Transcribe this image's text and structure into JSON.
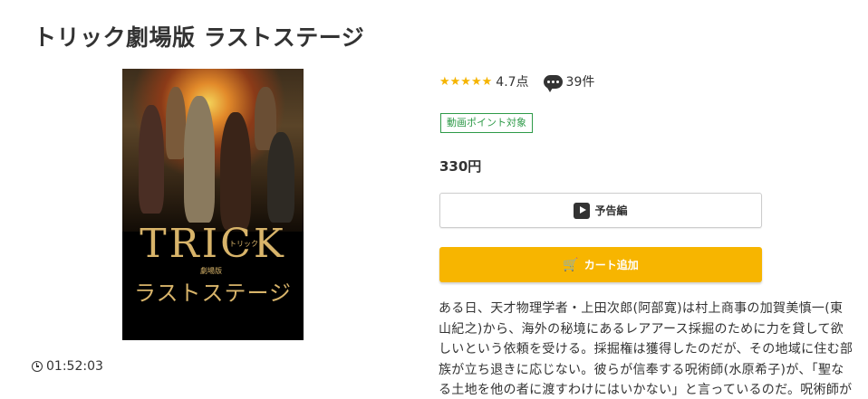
{
  "page": {
    "title": "トリック劇場版 ラストステージ"
  },
  "poster": {
    "logo_text": "TRICK",
    "logo_tag": "トリック",
    "edition_tag": "劇場版",
    "subtitle": "ラストステージ"
  },
  "duration": "01:52:03",
  "rating": {
    "stars_display": "★★★★★",
    "score": "4.7点",
    "reviews": "39件"
  },
  "badge": "動画ポイント対象",
  "price": "330円",
  "buttons": {
    "trailer_label": "予告編",
    "cart_label": "カート追加"
  },
  "description": "ある日、天才物理学者・上田次郎(阿部寛)は村上商事の加賀美慎一(東山紀之)から、海外の秘境にあるレアアース採掘のために力を貸して欲しいという依頼を受ける。採掘権は獲得したのだが、その地域に住む部族が立ち退きに応じない。彼らが信奉する呪術師(水原希子)が、「聖なる土地を他の者に渡すわけにはいかない」と言っているのだ。呪術師が",
  "colors": {
    "accent_yellow": "#f7b500",
    "star": "#f5b400",
    "badge_green": "#2e9a48"
  }
}
